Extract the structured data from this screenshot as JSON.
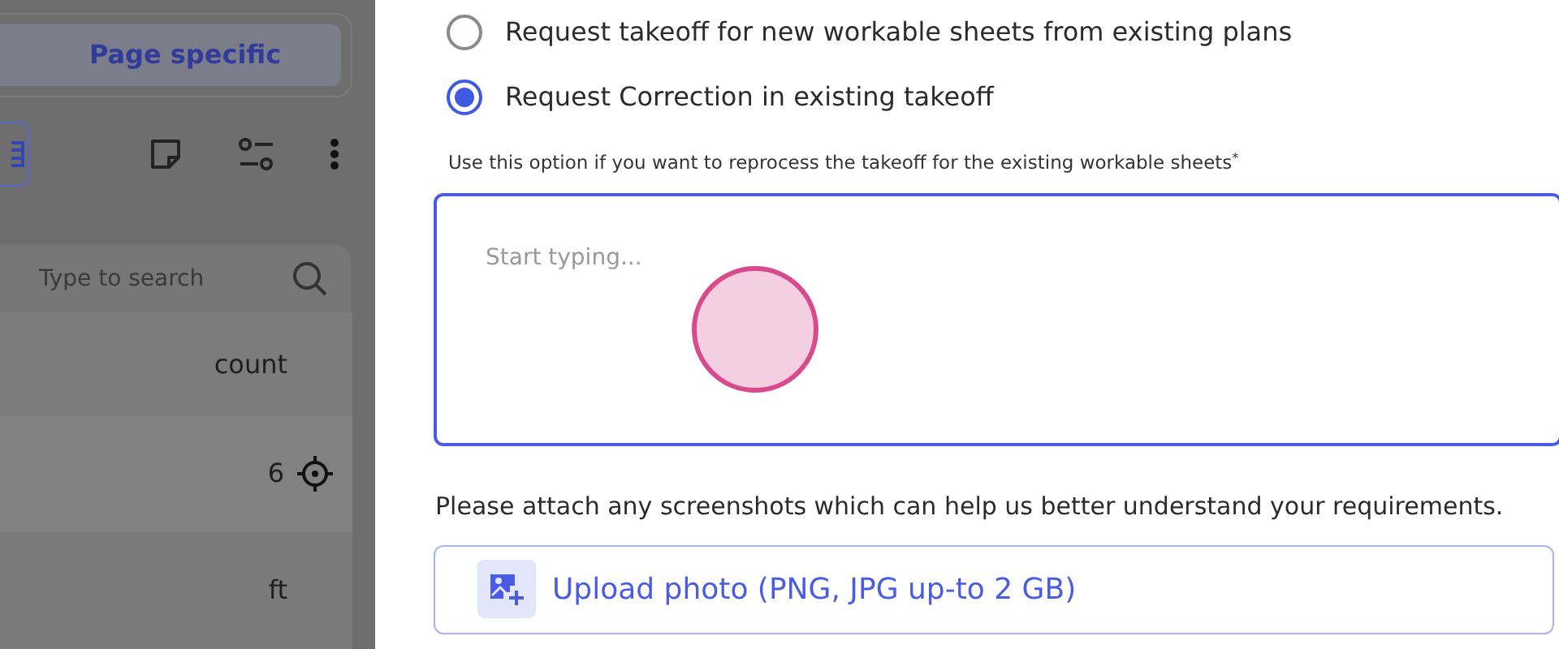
{
  "sidebar": {
    "tab": {
      "label": "Page specific",
      "selected": true
    },
    "search": {
      "placeholder": "Type to search"
    },
    "table": {
      "header": "count",
      "rows": [
        {
          "value": "6",
          "kind": "locate"
        },
        {
          "value": "ft",
          "kind": "plain"
        }
      ]
    }
  },
  "form": {
    "options": [
      {
        "label": "Request takeoff for new workable sheets from existing plans",
        "selected": false
      },
      {
        "label": "Request Correction in existing takeoff",
        "selected": true
      }
    ],
    "hint": "Use this option if you want to reprocess the takeoff for the existing workable sheets$^{*}$",
    "details": {
      "placeholder": "Start typing..."
    },
    "attach_prompt": "Please attach any screenshots which can help us better understand your requirements.",
    "upload_button": "Upload photo (PNG, JPG up-to 2 GB)"
  }
}
